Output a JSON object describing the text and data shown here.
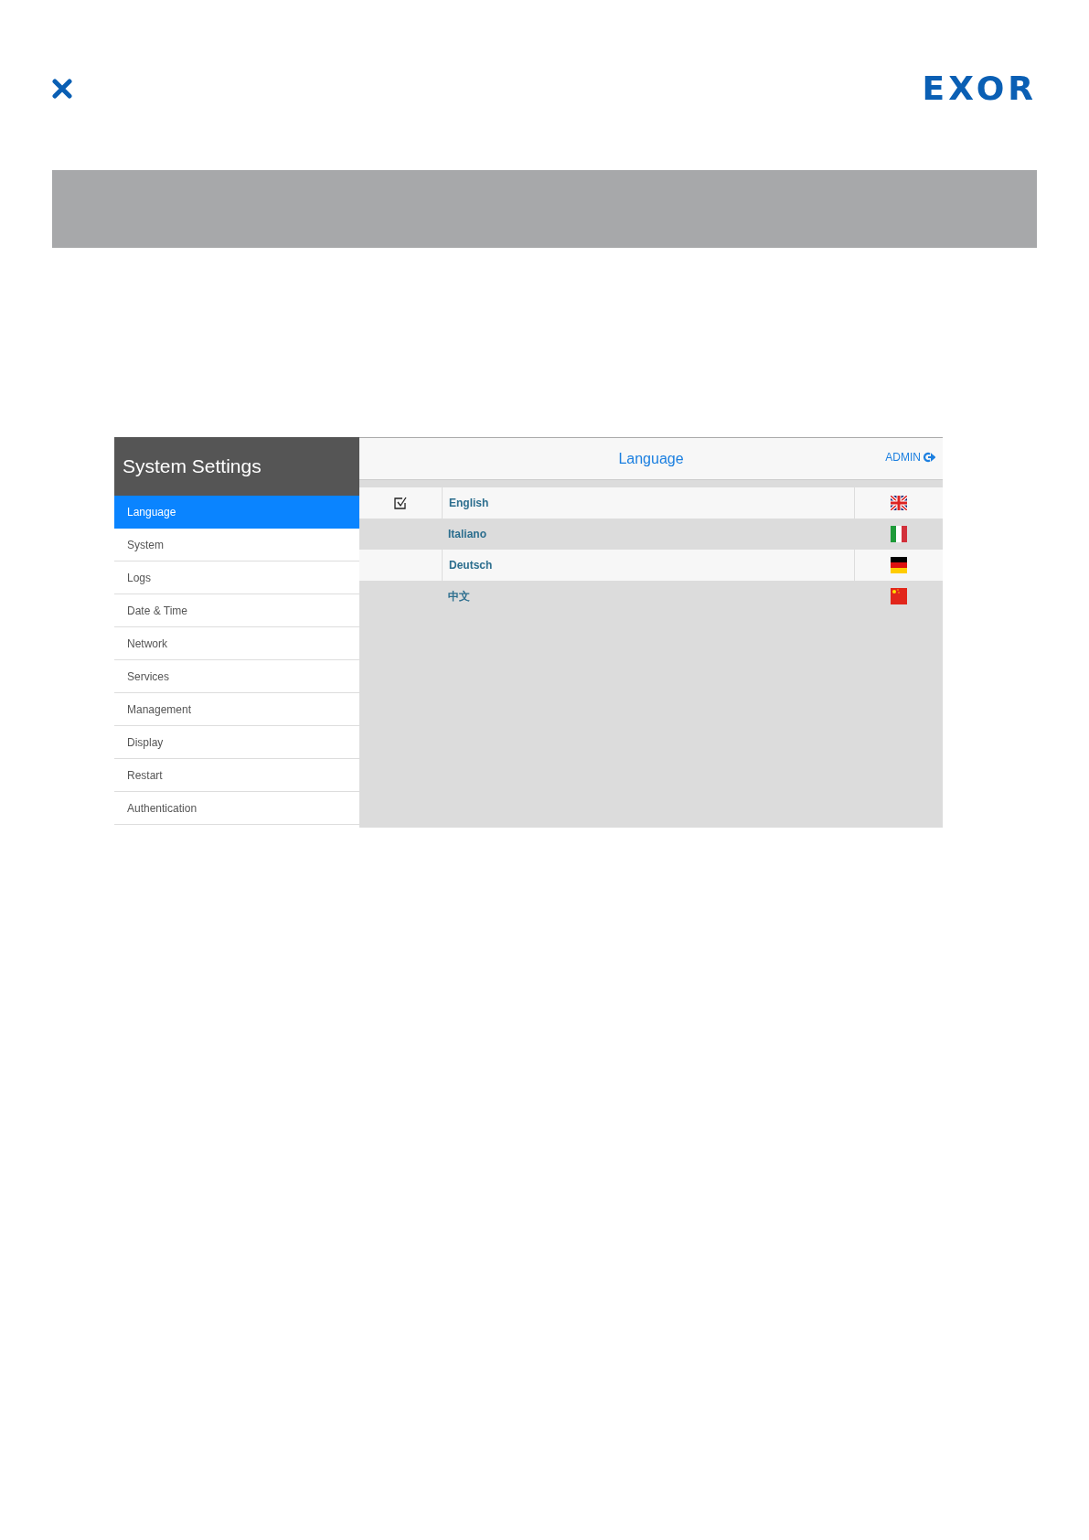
{
  "page": {
    "logo": "EXOR"
  },
  "app": {
    "sidebar": {
      "title": "System Settings",
      "items": [
        {
          "label": "Language",
          "selected": true
        },
        {
          "label": "System",
          "selected": false
        },
        {
          "label": "Logs",
          "selected": false
        },
        {
          "label": "Date & Time",
          "selected": false
        },
        {
          "label": "Network",
          "selected": false
        },
        {
          "label": "Services",
          "selected": false
        },
        {
          "label": "Management",
          "selected": false
        },
        {
          "label": "Display",
          "selected": false
        },
        {
          "label": "Restart",
          "selected": false
        },
        {
          "label": "Authentication",
          "selected": false
        }
      ]
    },
    "header": {
      "title": "Language",
      "user": "ADMIN"
    },
    "languages": [
      {
        "label": "English",
        "checked": true,
        "kind": "uk"
      },
      {
        "label": "Italiano",
        "checked": false,
        "kind": "it"
      },
      {
        "label": "Deutsch",
        "checked": false,
        "kind": "de"
      },
      {
        "label": "中文",
        "checked": false,
        "kind": "cn"
      }
    ]
  }
}
